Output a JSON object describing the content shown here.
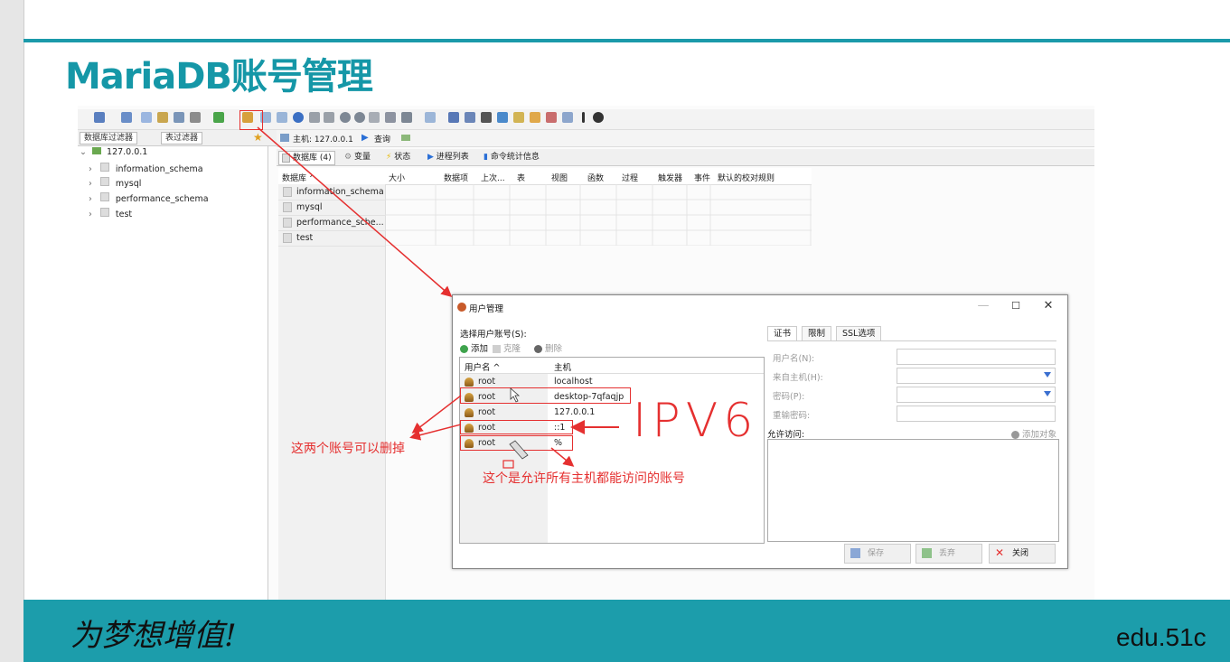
{
  "slide": {
    "title": "MariaDB账号管理",
    "slogan": "为梦想增值!",
    "site": "edu.51c"
  },
  "filters": {
    "db_filter": "数据库过滤器",
    "table_filter": "表过滤器"
  },
  "tree": {
    "root": "127.0.0.1",
    "items": [
      {
        "label": "information_schema"
      },
      {
        "label": "mysql"
      },
      {
        "label": "performance_schema"
      },
      {
        "label": "test"
      }
    ]
  },
  "hostbar": {
    "host_label": "主机: 127.0.0.1",
    "query_label": "查询"
  },
  "tabs": [
    {
      "label": "数据库 (4)"
    },
    {
      "label": "变量"
    },
    {
      "label": "状态"
    },
    {
      "label": "进程列表"
    },
    {
      "label": "命令统计信息"
    }
  ],
  "grid": {
    "columns": [
      "数据库 ^",
      "大小",
      "数据项",
      "上次...",
      "表",
      "视图",
      "函数",
      "过程",
      "触发器",
      "事件",
      "默认的校对规则"
    ],
    "rows": [
      "information_schema",
      "mysql",
      "performance_sche...",
      "test"
    ]
  },
  "dialog": {
    "title": "用户管理",
    "select_label": "选择用户账号(S):",
    "add_label": "添加",
    "clone_label": "克隆",
    "delete_label": "删除",
    "col_user": "用户名 ^",
    "col_host": "主机",
    "users": [
      {
        "name": "root",
        "host": "localhost"
      },
      {
        "name": "root",
        "host": "desktop-7qfaqjp"
      },
      {
        "name": "root",
        "host": "127.0.0.1"
      },
      {
        "name": "root",
        "host": "::1"
      },
      {
        "name": "root",
        "host": "%"
      }
    ],
    "right_tabs": [
      "证书",
      "限制",
      "SSL选项"
    ],
    "fields": [
      {
        "label": "用户名(N):"
      },
      {
        "label": "来自主机(H):"
      },
      {
        "label": "密码(P):"
      },
      {
        "label": "重输密码:"
      }
    ],
    "access_label": "允许访问:",
    "add_object_label": "添加对象",
    "save_label": "保存",
    "discard_label": "丢弃",
    "close_label": "关闭",
    "minimize_glyph": "—",
    "maximize_glyph": "☐",
    "close_glyph": "✕"
  },
  "annotations": {
    "deletable": "这两个账号可以删掉",
    "ipv6": "IPV6",
    "all_hosts": "这个是允许所有主机都能访问的账号"
  },
  "colors": {
    "accent": "#1c9dab",
    "annotation": "#e53030"
  }
}
